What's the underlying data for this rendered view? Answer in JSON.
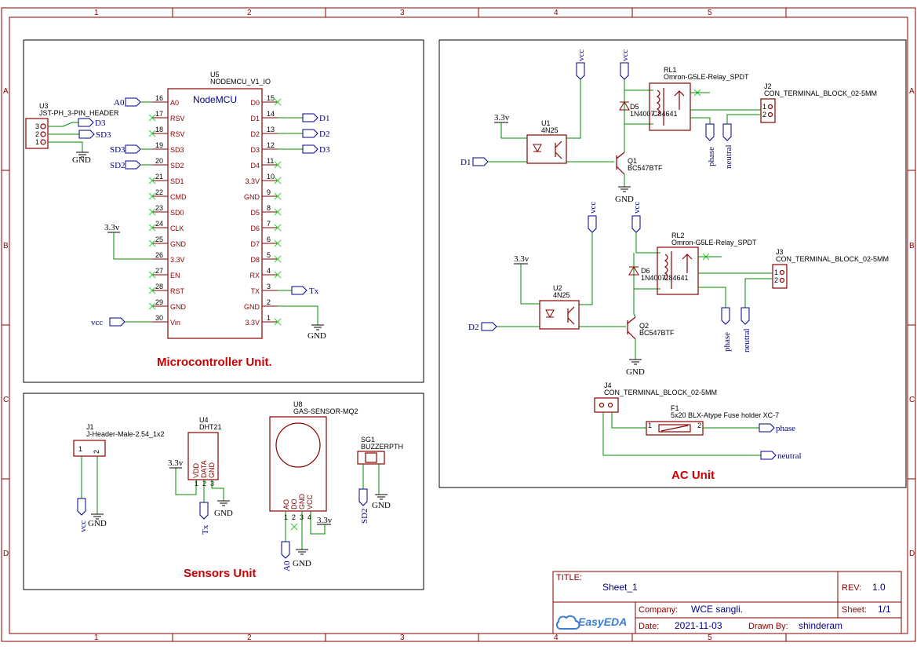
{
  "grid": {
    "columns": [
      "1",
      "2",
      "3",
      "4",
      "5"
    ],
    "rows": [
      "A",
      "B",
      "C",
      "D"
    ]
  },
  "sections": {
    "micro": "Microcontroller Unit.",
    "sensors": "Sensors Unit",
    "ac": "AC Unit"
  },
  "title_block": {
    "title_label": "TITLE:",
    "title_value": "Sheet_1",
    "rev_label": "REV:",
    "rev_value": "1.0",
    "company_label": "Company:",
    "company_value": "WCE sangli.",
    "sheet_label": "Sheet:",
    "sheet_value": "1/1",
    "date_label": "Date:",
    "date_value": "2021-11-03",
    "drawn_label": "Drawn By:",
    "drawn_value": "shinderam",
    "logo_text": "EasyEDA"
  },
  "power": {
    "gnd": "GND",
    "v33": "3.3v",
    "vcc": "vcc"
  },
  "nets": {
    "A0": "A0",
    "D1": "D1",
    "D2": "D2",
    "D3": "D3",
    "SD2": "SD2",
    "SD3": "SD3",
    "Tx": "Tx",
    "vcc": "vcc",
    "phase": "phase",
    "neutral": "neutral"
  },
  "u5": {
    "ref": "U5",
    "part": "NODEMCU_V1_IO",
    "label": "NodeMCU",
    "left_pins": [
      {
        "num": "16",
        "name": "A0"
      },
      {
        "num": "17",
        "name": "RSV"
      },
      {
        "num": "18",
        "name": "RSV"
      },
      {
        "num": "19",
        "name": "SD3"
      },
      {
        "num": "20",
        "name": "SD2"
      },
      {
        "num": "21",
        "name": "SD1"
      },
      {
        "num": "22",
        "name": "CMD"
      },
      {
        "num": "23",
        "name": "SD0"
      },
      {
        "num": "24",
        "name": "CLK"
      },
      {
        "num": "25",
        "name": "GND"
      },
      {
        "num": "26",
        "name": "3.3V"
      },
      {
        "num": "27",
        "name": "EN"
      },
      {
        "num": "28",
        "name": "RST"
      },
      {
        "num": "29",
        "name": "GND"
      },
      {
        "num": "30",
        "name": "Vin"
      }
    ],
    "right_pins": [
      {
        "num": "15",
        "name": "D0"
      },
      {
        "num": "14",
        "name": "D1"
      },
      {
        "num": "13",
        "name": "D2"
      },
      {
        "num": "12",
        "name": "D3"
      },
      {
        "num": "11",
        "name": "D4"
      },
      {
        "num": "10",
        "name": "3.3V"
      },
      {
        "num": "9",
        "name": "GND"
      },
      {
        "num": "8",
        "name": "D5"
      },
      {
        "num": "7",
        "name": "D6"
      },
      {
        "num": "6",
        "name": "D7"
      },
      {
        "num": "5",
        "name": "D8"
      },
      {
        "num": "4",
        "name": "RX"
      },
      {
        "num": "3",
        "name": "TX"
      },
      {
        "num": "2",
        "name": "GND"
      },
      {
        "num": "1",
        "name": "3.3V"
      }
    ]
  },
  "u3": {
    "ref": "U3",
    "part": "JST-PH_3-PIN_HEADER",
    "pins": [
      "3",
      "2",
      "1"
    ]
  },
  "u1": {
    "ref": "U1",
    "part": "4N25"
  },
  "u2": {
    "ref": "U2",
    "part": "4N25"
  },
  "q1": {
    "ref": "Q1",
    "part": "BC547BTF"
  },
  "q2": {
    "ref": "Q2",
    "part": "BC547BTF"
  },
  "rl1": {
    "ref": "RL1",
    "part": "Omron-G5LE-Relay_SPDT"
  },
  "rl2": {
    "ref": "RL2",
    "part": "Omron-G5LE-Relay_SPDT"
  },
  "d5": {
    "ref": "D5",
    "part": "1N4007",
    "lcsc": "C84641"
  },
  "d6": {
    "ref": "D6",
    "part": "1N4007",
    "lcsc": "C84641"
  },
  "j2": {
    "ref": "J2",
    "part": "CON_TERMINAL_BLOCK_02-5MM",
    "pins": [
      "1",
      "2"
    ]
  },
  "j3": {
    "ref": "J3",
    "part": "CON_TERMINAL_BLOCK_02-5MM",
    "pins": [
      "1",
      "2"
    ]
  },
  "j4": {
    "ref": "J4",
    "part": "CON_TERMINAL_BLOCK_02-5MM",
    "pins": [
      "1",
      "2"
    ]
  },
  "f1": {
    "ref": "F1",
    "part": "5x20 BLX-Atype Fuse holder XC-7",
    "pins": [
      "1",
      "2"
    ]
  },
  "j1": {
    "ref": "J1",
    "part": "J-Header-Male-2.54_1x2",
    "pins": [
      "1",
      "2"
    ]
  },
  "u4": {
    "ref": "U4",
    "part": "DHT21",
    "pins": [
      "VDD",
      "DATA",
      "GND"
    ],
    "nums": [
      "1",
      "2",
      "3"
    ]
  },
  "u8": {
    "ref": "U8",
    "part": "GAS-SENSOR-MQ2",
    "pins": [
      "AO",
      "DO",
      "GND",
      "VCC"
    ],
    "nums": [
      "1",
      "2",
      "3",
      "4"
    ]
  },
  "sg1": {
    "ref": "SG1",
    "part": "BUZZERPTH"
  }
}
